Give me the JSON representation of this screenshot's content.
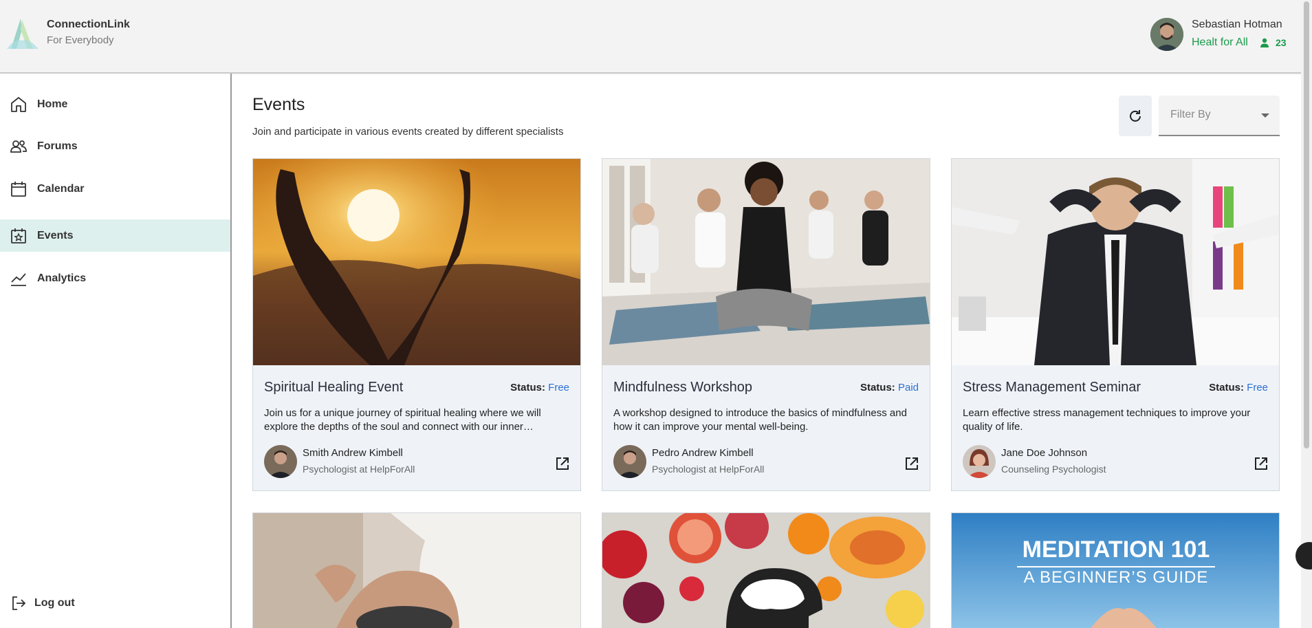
{
  "header": {
    "brand_name": "ConnectionLink",
    "brand_tag": "For Everybody",
    "user_name": "Sebastian Hotman",
    "user_org": "Healt for All",
    "user_count": "23"
  },
  "sidebar": {
    "items": [
      {
        "label": "Home",
        "icon": "home-icon"
      },
      {
        "label": "Forums",
        "icon": "users-icon"
      },
      {
        "label": "Calendar",
        "icon": "calendar-icon"
      },
      {
        "label": "Events",
        "icon": "calendar-star-icon",
        "active": true
      },
      {
        "label": "Analytics",
        "icon": "chart-line-icon"
      }
    ],
    "logout_label": "Log out"
  },
  "main": {
    "title": "Events",
    "subtitle": "Join and participate in various events created by different specialists",
    "filter_placeholder": "Filter By"
  },
  "cards": [
    {
      "title": "Spiritual Healing Event",
      "status_label": "Status:",
      "status": "Free",
      "description": "Join us for a unique journey of spiritual healing where we will explore the depths of the soul and connect with our inner…",
      "author": "Smith Andrew Kimbell",
      "role": "Psychologist at HelpForAll"
    },
    {
      "title": "Mindfulness Workshop",
      "status_label": "Status:",
      "status": "Paid",
      "description": "A workshop designed to introduce the basics of mindfulness and how it can improve your mental well-being.",
      "author": "Pedro Andrew Kimbell",
      "role": "Psychologist at HelpForAll"
    },
    {
      "title": "Stress Management Seminar",
      "status_label": "Status:",
      "status": "Free",
      "description": "Learn effective stress management techniques to improve your quality of life.",
      "author": "Jane Doe Johnson",
      "role": "Counseling Psychologist"
    }
  ],
  "cards_row2": [
    {
      "image_text_1": "",
      "image_text_2": ""
    },
    {
      "image_text_1": "",
      "image_text_2": ""
    },
    {
      "image_text_1": "MEDITATION 101",
      "image_text_2": "A BEGINNER’S GUIDE"
    }
  ],
  "colors": {
    "accent_green": "#1a9a4a",
    "active_nav": "#def0ee",
    "status_blue": "#2c6fd1"
  }
}
